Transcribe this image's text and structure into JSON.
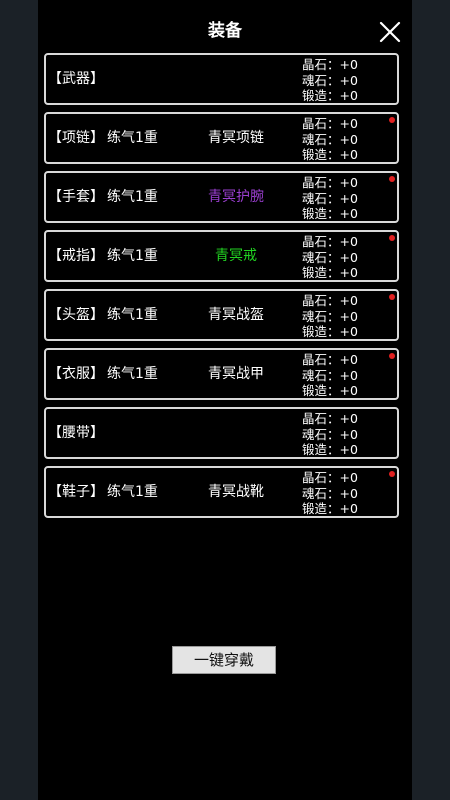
{
  "header": {
    "title": "装备"
  },
  "slots": [
    {
      "name": "【武器】",
      "level": "",
      "item": "",
      "item_color": "#ffffff",
      "red_dot": false,
      "stats": [
        "晶石：+0",
        "魂石：+0",
        "锻造：+0"
      ]
    },
    {
      "name": "【项链】",
      "level": "练气1重",
      "item": "青冥项链",
      "item_color": "#ffffff",
      "red_dot": true,
      "stats": [
        "晶石：+0",
        "魂石：+0",
        "锻造：+0"
      ]
    },
    {
      "name": "【手套】",
      "level": "练气1重",
      "item": "青冥护腕",
      "item_color": "#9b3fd1",
      "red_dot": true,
      "stats": [
        "晶石：+0",
        "魂石：+0",
        "锻造：+0"
      ]
    },
    {
      "name": "【戒指】",
      "level": "练气1重",
      "item": "青冥戒",
      "item_color": "#22d222",
      "red_dot": true,
      "stats": [
        "晶石：+0",
        "魂石：+0",
        "锻造：+0"
      ]
    },
    {
      "name": "【头盔】",
      "level": "练气1重",
      "item": "青冥战盔",
      "item_color": "#ffffff",
      "red_dot": true,
      "stats": [
        "晶石：+0",
        "魂石：+0",
        "锻造：+0"
      ]
    },
    {
      "name": "【衣服】",
      "level": "练气1重",
      "item": "青冥战甲",
      "item_color": "#ffffff",
      "red_dot": true,
      "stats": [
        "晶石：+0",
        "魂石：+0",
        "锻造：+0"
      ]
    },
    {
      "name": "【腰带】",
      "level": "",
      "item": "",
      "item_color": "#ffffff",
      "red_dot": false,
      "stats": [
        "晶石：+0",
        "魂石：+0",
        "锻造：+0"
      ]
    },
    {
      "name": "【鞋子】",
      "level": "练气1重",
      "item": "青冥战靴",
      "item_color": "#ffffff",
      "red_dot": true,
      "stats": [
        "晶石：+0",
        "魂石：+0",
        "锻造：+0"
      ]
    }
  ],
  "actions": {
    "equip_all_label": "一键穿戴"
  },
  "colors": {
    "background": "#000000",
    "border": "#d9d9d9",
    "notification_dot": "#e02020"
  },
  "icons": {
    "close": "close-icon"
  }
}
